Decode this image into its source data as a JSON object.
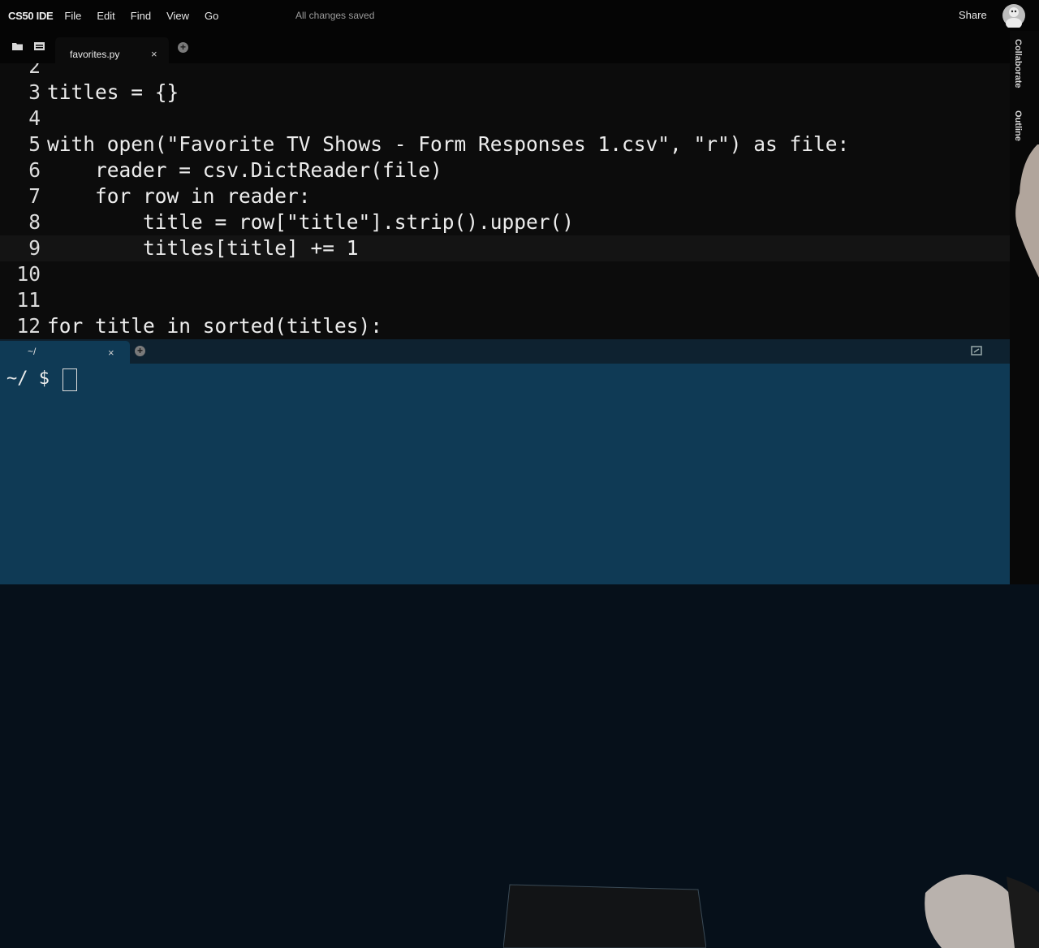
{
  "menubar": {
    "brand": "CS50 IDE",
    "menus": [
      "File",
      "Edit",
      "Find",
      "View",
      "Go"
    ],
    "status": "All changes saved",
    "share": "Share"
  },
  "tabs": {
    "file_tab": "favorites.py",
    "close": "×",
    "add": "+"
  },
  "side_panel": {
    "collaborate": "Collaborate",
    "outline": "Outline"
  },
  "editor": {
    "lines": [
      {
        "num": "2",
        "code": ""
      },
      {
        "num": "3",
        "code": "titles = {}"
      },
      {
        "num": "4",
        "code": ""
      },
      {
        "num": "5",
        "code": "with open(\"Favorite TV Shows - Form Responses 1.csv\", \"r\") as file:"
      },
      {
        "num": "6",
        "code": "    reader = csv.DictReader(file)"
      },
      {
        "num": "7",
        "code": "    for row in reader:"
      },
      {
        "num": "8",
        "code": "        title = row[\"title\"].strip().upper()"
      },
      {
        "num": "9",
        "code": "        titles[title] += 1"
      },
      {
        "num": "10",
        "code": ""
      },
      {
        "num": "11",
        "code": ""
      },
      {
        "num": "12",
        "code": "for title in sorted(titles):"
      }
    ],
    "active_line": "9"
  },
  "terminal": {
    "tab_label": "~/",
    "close": "×",
    "add": "+",
    "prompt": "~/ $"
  },
  "colors": {
    "editor_bg": "#0c0c0c",
    "terminal_bg": "#0f3a55",
    "menubar_bg": "#050505"
  }
}
